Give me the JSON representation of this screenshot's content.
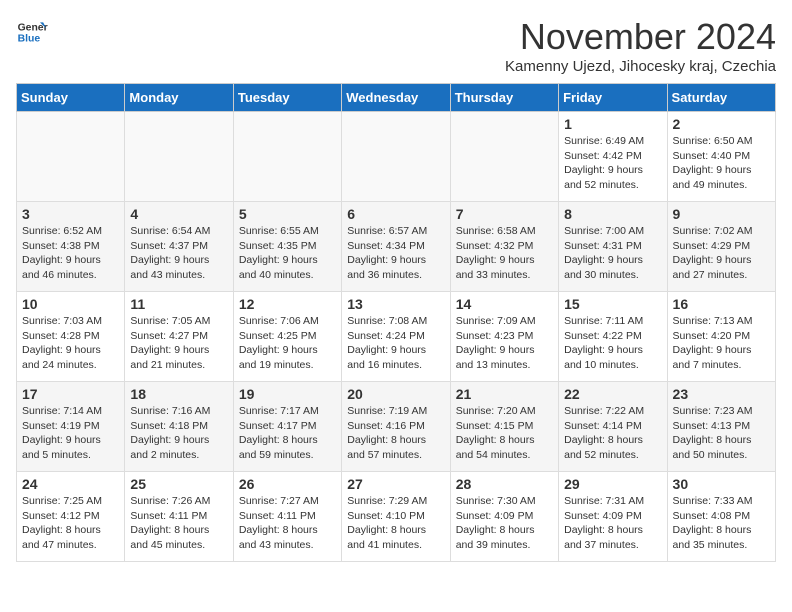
{
  "logo": {
    "line1": "General",
    "line2": "Blue"
  },
  "title": "November 2024",
  "subtitle": "Kamenny Ujezd, Jihocesky kraj, Czechia",
  "days_of_week": [
    "Sunday",
    "Monday",
    "Tuesday",
    "Wednesday",
    "Thursday",
    "Friday",
    "Saturday"
  ],
  "weeks": [
    [
      {
        "day": "",
        "info": ""
      },
      {
        "day": "",
        "info": ""
      },
      {
        "day": "",
        "info": ""
      },
      {
        "day": "",
        "info": ""
      },
      {
        "day": "",
        "info": ""
      },
      {
        "day": "1",
        "info": "Sunrise: 6:49 AM\nSunset: 4:42 PM\nDaylight: 9 hours\nand 52 minutes."
      },
      {
        "day": "2",
        "info": "Sunrise: 6:50 AM\nSunset: 4:40 PM\nDaylight: 9 hours\nand 49 minutes."
      }
    ],
    [
      {
        "day": "3",
        "info": "Sunrise: 6:52 AM\nSunset: 4:38 PM\nDaylight: 9 hours\nand 46 minutes."
      },
      {
        "day": "4",
        "info": "Sunrise: 6:54 AM\nSunset: 4:37 PM\nDaylight: 9 hours\nand 43 minutes."
      },
      {
        "day": "5",
        "info": "Sunrise: 6:55 AM\nSunset: 4:35 PM\nDaylight: 9 hours\nand 40 minutes."
      },
      {
        "day": "6",
        "info": "Sunrise: 6:57 AM\nSunset: 4:34 PM\nDaylight: 9 hours\nand 36 minutes."
      },
      {
        "day": "7",
        "info": "Sunrise: 6:58 AM\nSunset: 4:32 PM\nDaylight: 9 hours\nand 33 minutes."
      },
      {
        "day": "8",
        "info": "Sunrise: 7:00 AM\nSunset: 4:31 PM\nDaylight: 9 hours\nand 30 minutes."
      },
      {
        "day": "9",
        "info": "Sunrise: 7:02 AM\nSunset: 4:29 PM\nDaylight: 9 hours\nand 27 minutes."
      }
    ],
    [
      {
        "day": "10",
        "info": "Sunrise: 7:03 AM\nSunset: 4:28 PM\nDaylight: 9 hours\nand 24 minutes."
      },
      {
        "day": "11",
        "info": "Sunrise: 7:05 AM\nSunset: 4:27 PM\nDaylight: 9 hours\nand 21 minutes."
      },
      {
        "day": "12",
        "info": "Sunrise: 7:06 AM\nSunset: 4:25 PM\nDaylight: 9 hours\nand 19 minutes."
      },
      {
        "day": "13",
        "info": "Sunrise: 7:08 AM\nSunset: 4:24 PM\nDaylight: 9 hours\nand 16 minutes."
      },
      {
        "day": "14",
        "info": "Sunrise: 7:09 AM\nSunset: 4:23 PM\nDaylight: 9 hours\nand 13 minutes."
      },
      {
        "day": "15",
        "info": "Sunrise: 7:11 AM\nSunset: 4:22 PM\nDaylight: 9 hours\nand 10 minutes."
      },
      {
        "day": "16",
        "info": "Sunrise: 7:13 AM\nSunset: 4:20 PM\nDaylight: 9 hours\nand 7 minutes."
      }
    ],
    [
      {
        "day": "17",
        "info": "Sunrise: 7:14 AM\nSunset: 4:19 PM\nDaylight: 9 hours\nand 5 minutes."
      },
      {
        "day": "18",
        "info": "Sunrise: 7:16 AM\nSunset: 4:18 PM\nDaylight: 9 hours\nand 2 minutes."
      },
      {
        "day": "19",
        "info": "Sunrise: 7:17 AM\nSunset: 4:17 PM\nDaylight: 8 hours\nand 59 minutes."
      },
      {
        "day": "20",
        "info": "Sunrise: 7:19 AM\nSunset: 4:16 PM\nDaylight: 8 hours\nand 57 minutes."
      },
      {
        "day": "21",
        "info": "Sunrise: 7:20 AM\nSunset: 4:15 PM\nDaylight: 8 hours\nand 54 minutes."
      },
      {
        "day": "22",
        "info": "Sunrise: 7:22 AM\nSunset: 4:14 PM\nDaylight: 8 hours\nand 52 minutes."
      },
      {
        "day": "23",
        "info": "Sunrise: 7:23 AM\nSunset: 4:13 PM\nDaylight: 8 hours\nand 50 minutes."
      }
    ],
    [
      {
        "day": "24",
        "info": "Sunrise: 7:25 AM\nSunset: 4:12 PM\nDaylight: 8 hours\nand 47 minutes."
      },
      {
        "day": "25",
        "info": "Sunrise: 7:26 AM\nSunset: 4:11 PM\nDaylight: 8 hours\nand 45 minutes."
      },
      {
        "day": "26",
        "info": "Sunrise: 7:27 AM\nSunset: 4:11 PM\nDaylight: 8 hours\nand 43 minutes."
      },
      {
        "day": "27",
        "info": "Sunrise: 7:29 AM\nSunset: 4:10 PM\nDaylight: 8 hours\nand 41 minutes."
      },
      {
        "day": "28",
        "info": "Sunrise: 7:30 AM\nSunset: 4:09 PM\nDaylight: 8 hours\nand 39 minutes."
      },
      {
        "day": "29",
        "info": "Sunrise: 7:31 AM\nSunset: 4:09 PM\nDaylight: 8 hours\nand 37 minutes."
      },
      {
        "day": "30",
        "info": "Sunrise: 7:33 AM\nSunset: 4:08 PM\nDaylight: 8 hours\nand 35 minutes."
      }
    ]
  ]
}
